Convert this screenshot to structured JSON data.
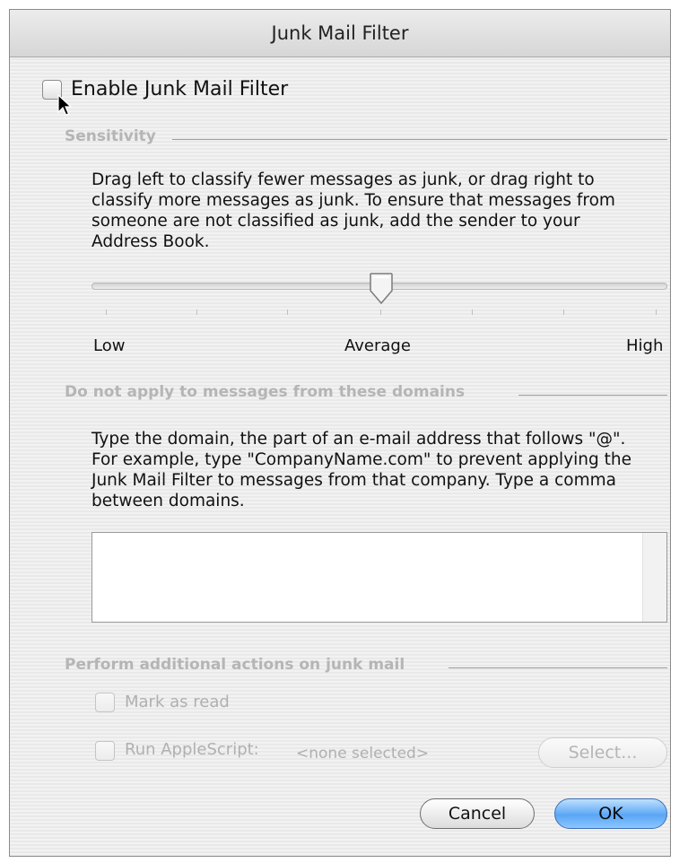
{
  "window": {
    "title": "Junk Mail Filter"
  },
  "enable_checkbox": {
    "label": "Enable Junk Mail Filter",
    "checked": false
  },
  "sensitivity": {
    "heading": "Sensitivity",
    "description_lines": [
      "Drag left to classify fewer messages as junk, or drag right to",
      "classify more messages as junk. To ensure that messages from",
      "someone are not classified as junk, add the sender to your",
      "Address Book."
    ],
    "slider": {
      "value": 0.5,
      "label_low": "Low",
      "label_mid": "Average",
      "label_high": "High"
    }
  },
  "domains": {
    "heading": "Do not apply to messages from these domains",
    "description_lines": [
      "Type the domain, the part of an e-mail address that follows \"@\".",
      "For example, type \"CompanyName.com\" to prevent applying the",
      "Junk Mail Filter to messages from that company. Type a comma",
      "between domains."
    ],
    "field_value": ""
  },
  "actions": {
    "heading": "Perform additional actions on junk mail",
    "mark_as_read_label": "Mark as read",
    "run_applescript_label": "Run AppleScript:",
    "script_value": "<none selected>",
    "select_button": "Select..."
  },
  "buttons": {
    "cancel": "Cancel",
    "ok": "OK"
  }
}
